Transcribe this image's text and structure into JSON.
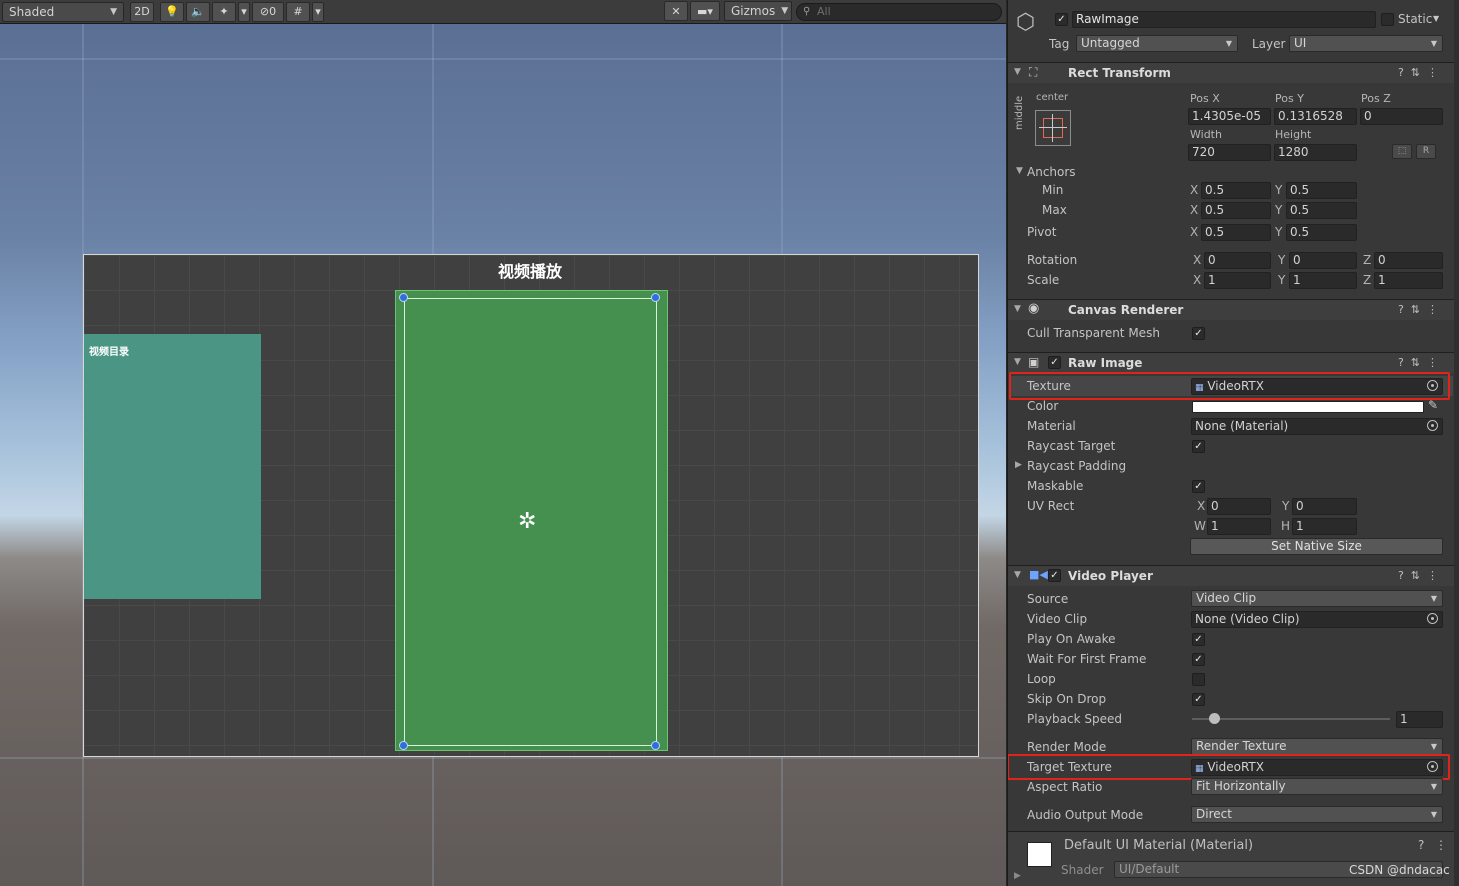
{
  "scene": {
    "shading": "Shaded",
    "mode_2d": "2D",
    "hidden_count": "0",
    "gizmos": "Gizmos",
    "search_placeholder": "All",
    "canvas_title": "视频播放",
    "list_title": "视频目录"
  },
  "inspector": {
    "object_name": "RawImage",
    "static_label": "Static",
    "tag_label": "Tag",
    "tag_value": "Untagged",
    "layer_label": "Layer",
    "layer_value": "UI",
    "rect_transform": {
      "title": "Rect Transform",
      "anchor_h": "center",
      "anchor_v": "middle",
      "pos_x_label": "Pos X",
      "pos_x": "1.4305e-05",
      "pos_y_label": "Pos Y",
      "pos_y": "0.1316528",
      "pos_z_label": "Pos Z",
      "pos_z": "0",
      "width_label": "Width",
      "width": "720",
      "height_label": "Height",
      "height": "1280",
      "r_button": "R",
      "anchors_label": "Anchors",
      "min_label": "Min",
      "min_x": "0.5",
      "min_y": "0.5",
      "max_label": "Max",
      "max_x": "0.5",
      "max_y": "0.5",
      "pivot_label": "Pivot",
      "pivot_x": "0.5",
      "pivot_y": "0.5",
      "rotation_label": "Rotation",
      "rot_x": "0",
      "rot_y": "0",
      "rot_z": "0",
      "scale_label": "Scale",
      "scale_x": "1",
      "scale_y": "1",
      "scale_z": "1",
      "x": "X",
      "y": "Y",
      "z": "Z"
    },
    "canvas_renderer": {
      "title": "Canvas Renderer",
      "cull_label": "Cull Transparent Mesh"
    },
    "raw_image": {
      "title": "Raw Image",
      "texture_label": "Texture",
      "texture_value": "VideoRTX",
      "color_label": "Color",
      "material_label": "Material",
      "material_value": "None (Material)",
      "raycast_target_label": "Raycast Target",
      "raycast_padding_label": "Raycast Padding",
      "maskable_label": "Maskable",
      "uvrect_label": "UV Rect",
      "uv_x": "0",
      "uv_y": "0",
      "uv_w": "1",
      "uv_h": "1",
      "x": "X",
      "y": "Y",
      "w": "W",
      "h": "H",
      "set_native_size": "Set Native Size"
    },
    "video_player": {
      "title": "Video Player",
      "source_label": "Source",
      "source_value": "Video Clip",
      "clip_label": "Video Clip",
      "clip_value": "None (Video Clip)",
      "play_on_awake_label": "Play On Awake",
      "wait_first_frame_label": "Wait For First Frame",
      "loop_label": "Loop",
      "skip_on_drop_label": "Skip On Drop",
      "playback_speed_label": "Playback Speed",
      "playback_speed_value": "1",
      "render_mode_label": "Render Mode",
      "render_mode_value": "Render Texture",
      "target_texture_label": "Target Texture",
      "target_texture_value": "VideoRTX",
      "aspect_ratio_label": "Aspect Ratio",
      "aspect_ratio_value": "Fit Horizontally",
      "audio_output_label": "Audio Output Mode",
      "audio_output_value": "Direct"
    },
    "material_footer": {
      "title": "Default UI Material (Material)",
      "shader_label": "Shader",
      "shader_value": "UI/Default"
    },
    "watermark": "CSDN @dndacac"
  }
}
